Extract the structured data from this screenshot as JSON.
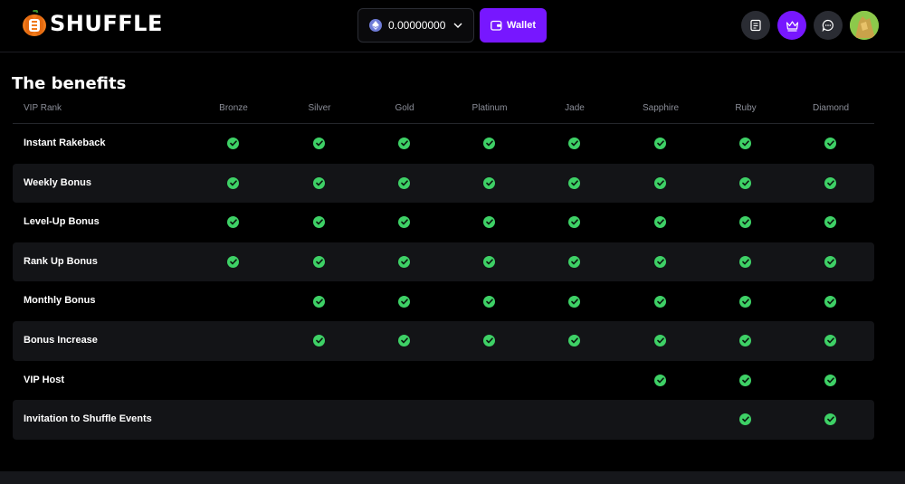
{
  "header": {
    "logo_text": "SHUFFLE",
    "balance": "0.00000000",
    "balance_currency_icon": "ethereum-icon",
    "wallet_label": "Wallet",
    "icons": [
      "receipt-icon",
      "crown-icon",
      "chat-icon"
    ],
    "accent_color": "#7717ff"
  },
  "benefits": {
    "title": "The benefits",
    "rank_header": "VIP Rank",
    "ranks": [
      "Bronze",
      "Silver",
      "Gold",
      "Platinum",
      "Jade",
      "Sapphire",
      "Ruby",
      "Diamond"
    ],
    "rows": [
      {
        "label": "Instant Rakeback",
        "included": [
          true,
          true,
          true,
          true,
          true,
          true,
          true,
          true
        ]
      },
      {
        "label": "Weekly Bonus",
        "included": [
          true,
          true,
          true,
          true,
          true,
          true,
          true,
          true
        ]
      },
      {
        "label": "Level-Up Bonus",
        "included": [
          true,
          true,
          true,
          true,
          true,
          true,
          true,
          true
        ]
      },
      {
        "label": "Rank Up Bonus",
        "included": [
          true,
          true,
          true,
          true,
          true,
          true,
          true,
          true
        ]
      },
      {
        "label": "Monthly Bonus",
        "included": [
          false,
          true,
          true,
          true,
          true,
          true,
          true,
          true
        ]
      },
      {
        "label": "Bonus Increase",
        "included": [
          false,
          true,
          true,
          true,
          true,
          true,
          true,
          true
        ]
      },
      {
        "label": "VIP Host",
        "included": [
          false,
          false,
          false,
          false,
          false,
          true,
          true,
          true
        ]
      },
      {
        "label": "Invitation to Shuffle Events",
        "included": [
          false,
          false,
          false,
          false,
          false,
          false,
          true,
          true
        ]
      }
    ],
    "check_color": "#3ed166"
  }
}
